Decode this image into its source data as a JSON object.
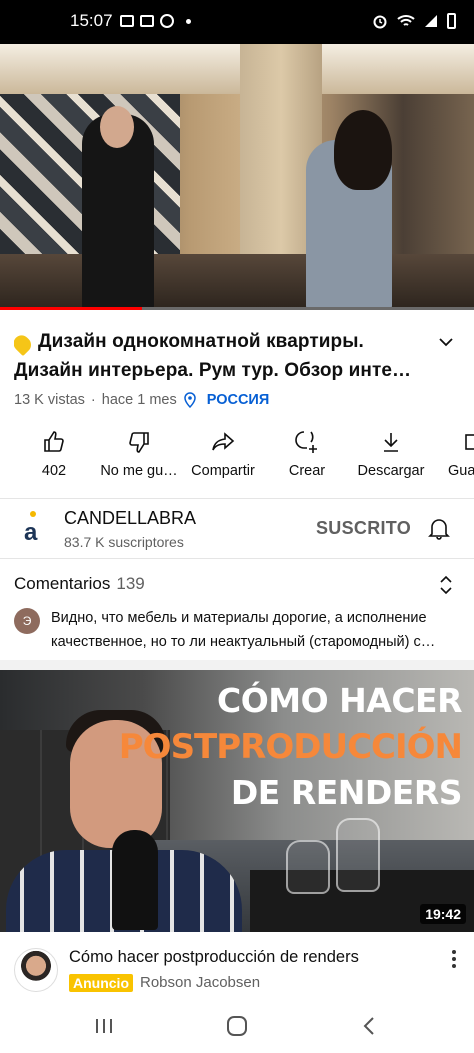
{
  "status_bar": {
    "time": "15:07"
  },
  "player": {
    "progress": 0.3
  },
  "video": {
    "title": "Дизайн однокомнатной квартиры. Дизайн интерьера. Рум тур. Обзор инте…",
    "views": "13 K vistas",
    "age": "hace 1 mes",
    "location_tag": "РОССИЯ"
  },
  "actions": [
    {
      "icon": "thumbs-up-icon",
      "label": "402"
    },
    {
      "icon": "thumbs-down-icon",
      "label": "No me gu…"
    },
    {
      "icon": "share-icon",
      "label": "Compartir"
    },
    {
      "icon": "create-icon",
      "label": "Crear"
    },
    {
      "icon": "download-icon",
      "label": "Descargar"
    },
    {
      "icon": "save-icon",
      "label": "Gua"
    }
  ],
  "channel": {
    "name": "CANDELLABRA",
    "subscribers": "83.7 K suscriptores",
    "subscribe_label": "SUSCRITO",
    "avatar_letter": "a"
  },
  "comments": {
    "header": "Comentarios",
    "count": "139",
    "first_author_initial": "Э",
    "first_text": "Видно, что мебель и материалы дорогие, а исполнение качественное, но то ли неактуальный (старомодный) с…"
  },
  "ad": {
    "thumbnail_line1": "CÓMO HACER",
    "thumbnail_line2": "POSTPRODUCCIÓN",
    "thumbnail_line3": "DE RENDERS",
    "duration": "19:42",
    "title": "Cómo hacer postproducción de renders",
    "badge": "Anuncio",
    "advertiser": "Robson Jacobsen"
  },
  "colors": {
    "accent_red": "#ff0000",
    "link_blue": "#065fd4",
    "ad_badge": "#f9c300",
    "thumb_orange": "#f6883a"
  }
}
